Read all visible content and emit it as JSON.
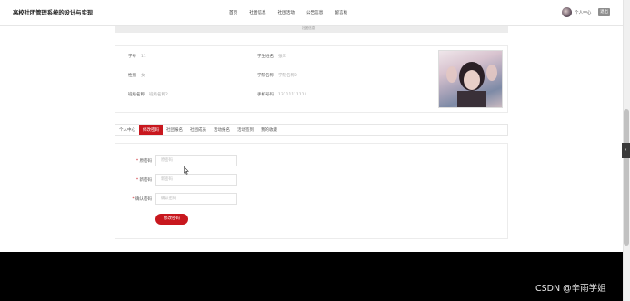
{
  "header": {
    "site_title": "高校社团管理系统的设计与实现",
    "nav": [
      "首页",
      "社团信息",
      "社团活动",
      "公告信息",
      "留言板"
    ],
    "profile_link": "个人中心",
    "logout": "退出"
  },
  "banner_text": "社团信息",
  "info": {
    "student_id_label": "学号",
    "student_id_value": "11",
    "student_name_label": "学生姓名",
    "student_name_value": "张三",
    "gender_label": "性别",
    "gender_value": "女",
    "college_label": "学院名称",
    "college_value": "学院名称2",
    "club_label": "班级名称",
    "club_value": "班级名称2",
    "phone_label": "手机号码",
    "phone_value": "13111111111"
  },
  "tabs": [
    "个人中心",
    "修改密码",
    "社团报名",
    "社团成员",
    "活动报名",
    "活动签到",
    "我的收藏"
  ],
  "active_tab_index": 1,
  "form": {
    "old_password_label": "原密码",
    "old_password_placeholder": "原密码",
    "new_password_label": "新密码",
    "new_password_placeholder": "新密码",
    "confirm_password_label": "确认密码",
    "confirm_password_placeholder": "确认密码",
    "required_mark": "*",
    "submit": "修改密码"
  },
  "watermark": "CSDN @辛雨学姐",
  "colors": {
    "accent": "#c8171e",
    "footer": "#000000"
  },
  "icons": {
    "cursor": "mouse-pointer-icon",
    "side_handle": "chevron-left-icon"
  }
}
